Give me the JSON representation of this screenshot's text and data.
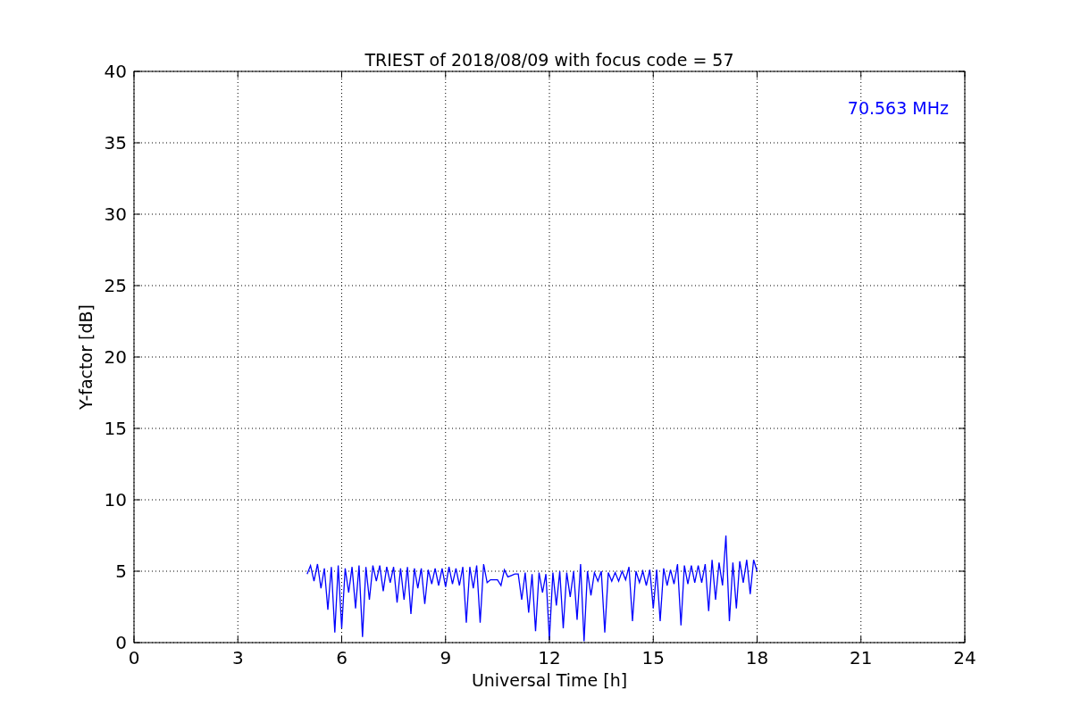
{
  "chart_data": {
    "type": "line",
    "title": "TRIEST of 2018/08/09 with focus code = 57",
    "xlabel": "Universal Time [h]",
    "ylabel": "Y-factor [dB]",
    "xlim": [
      0,
      24
    ],
    "ylim": [
      0,
      40
    ],
    "xticks": [
      0,
      3,
      6,
      9,
      12,
      15,
      18,
      21,
      24
    ],
    "yticks": [
      0,
      5,
      10,
      15,
      20,
      25,
      30,
      35,
      40
    ],
    "x": [
      5.0,
      5.1,
      5.2,
      5.3,
      5.4,
      5.5,
      5.6,
      5.7,
      5.8,
      5.9,
      6.0,
      6.1,
      6.2,
      6.3,
      6.4,
      6.5,
      6.6,
      6.7,
      6.8,
      6.9,
      7.0,
      7.1,
      7.2,
      7.3,
      7.4,
      7.5,
      7.6,
      7.7,
      7.8,
      7.9,
      8.0,
      8.1,
      8.2,
      8.3,
      8.4,
      8.5,
      8.6,
      8.7,
      8.8,
      8.9,
      9.0,
      9.1,
      9.2,
      9.3,
      9.4,
      9.5,
      9.6,
      9.7,
      9.8,
      9.9,
      10.0,
      10.1,
      10.2,
      10.3,
      10.4,
      10.5,
      10.6,
      10.7,
      10.8,
      10.9,
      11.0,
      11.1,
      11.2,
      11.3,
      11.4,
      11.5,
      11.6,
      11.7,
      11.8,
      11.9,
      12.0,
      12.1,
      12.2,
      12.3,
      12.4,
      12.5,
      12.6,
      12.7,
      12.8,
      12.9,
      13.0,
      13.1,
      13.2,
      13.3,
      13.4,
      13.5,
      13.6,
      13.7,
      13.8,
      13.9,
      14.0,
      14.1,
      14.2,
      14.3,
      14.4,
      14.5,
      14.6,
      14.7,
      14.8,
      14.9,
      15.0,
      15.1,
      15.2,
      15.3,
      15.4,
      15.5,
      15.6,
      15.7,
      15.8,
      15.9,
      16.0,
      16.1,
      16.2,
      16.3,
      16.4,
      16.5,
      16.6,
      16.7,
      16.8,
      16.9,
      17.0,
      17.1,
      17.2,
      17.3,
      17.4,
      17.5,
      17.6,
      17.7,
      17.8,
      17.9,
      18.0
    ],
    "series": [
      {
        "name": "70.563 MHz",
        "color": "#0000ff",
        "values": [
          4.8,
          5.4,
          4.3,
          5.5,
          3.8,
          5.2,
          2.3,
          5.3,
          0.7,
          5.4,
          1.0,
          5.2,
          3.5,
          5.3,
          2.4,
          5.4,
          0.4,
          5.3,
          3.0,
          5.4,
          4.3,
          5.4,
          3.6,
          5.3,
          4.2,
          5.3,
          2.8,
          5.2,
          3.0,
          5.3,
          2.0,
          5.2,
          3.8,
          5.2,
          2.7,
          5.1,
          4.1,
          5.2,
          4.0,
          5.2,
          3.9,
          5.3,
          4.1,
          5.2,
          4.0,
          5.3,
          1.4,
          5.3,
          3.8,
          5.4,
          1.4,
          5.5,
          4.2,
          4.4,
          4.4,
          4.4,
          4.0,
          5.1,
          4.6,
          4.7,
          4.8,
          4.8,
          3.0,
          4.9,
          2.1,
          4.8,
          0.8,
          4.9,
          3.5,
          4.8,
          0.2,
          4.9,
          2.6,
          5.0,
          1.0,
          4.9,
          3.2,
          5.0,
          1.6,
          5.5,
          0.1,
          5.0,
          3.3,
          4.9,
          4.3,
          5.0,
          0.7,
          4.9,
          4.3,
          4.9,
          4.3,
          5.0,
          4.4,
          5.3,
          1.5,
          5.0,
          4.2,
          5.0,
          4.0,
          5.1,
          2.4,
          5.1,
          1.5,
          5.2,
          4.0,
          5.1,
          4.1,
          5.5,
          1.2,
          5.4,
          4.1,
          5.4,
          4.2,
          5.4,
          4.2,
          5.5,
          2.2,
          5.8,
          3.0,
          5.6,
          4.0,
          7.5,
          1.5,
          5.6,
          2.4,
          5.7,
          4.2,
          5.8,
          3.4,
          5.8,
          5.0
        ]
      }
    ],
    "grid": true
  }
}
